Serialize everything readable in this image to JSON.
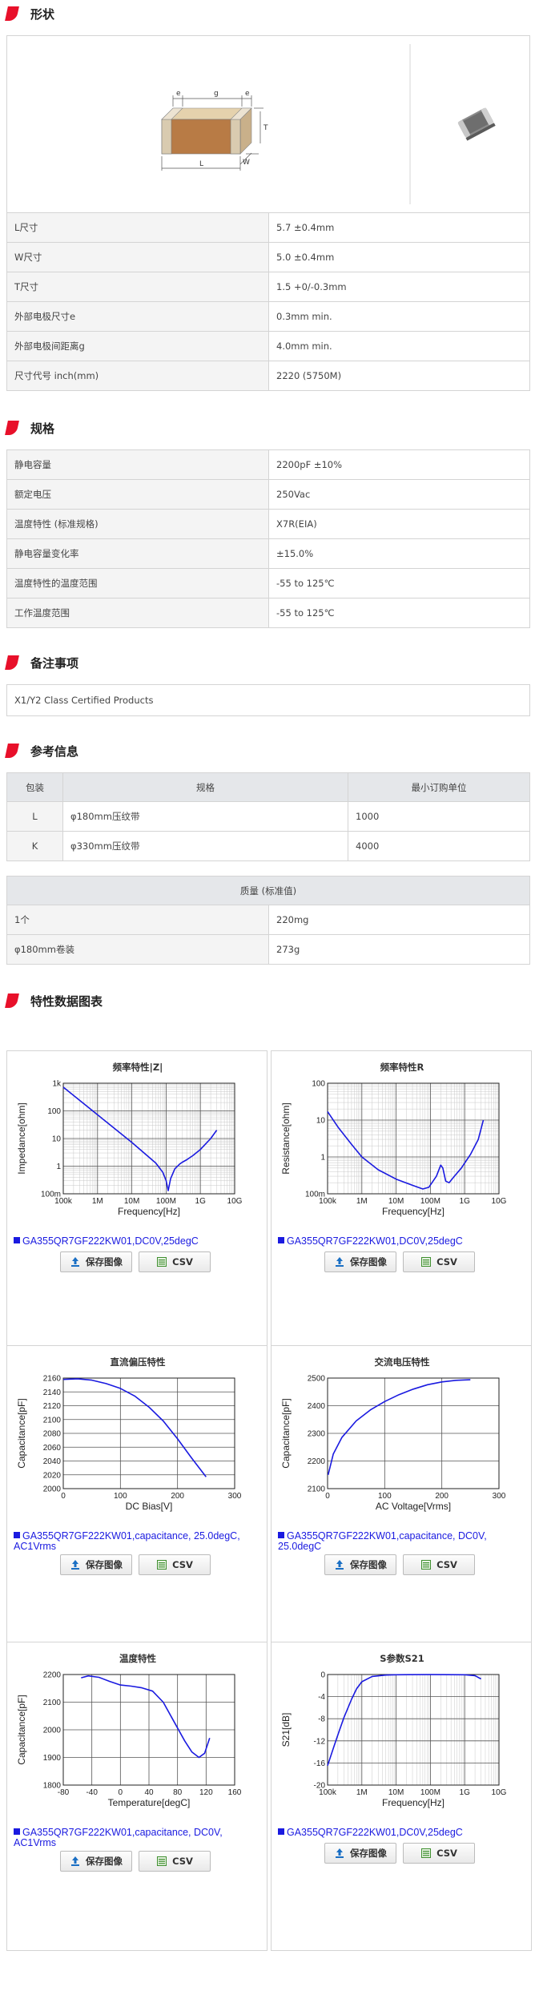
{
  "sections": {
    "shape": "形状",
    "spec": "规格",
    "remarks": "备注事项",
    "reference": "参考信息",
    "charts": "特性数据图表"
  },
  "dimension_labels": {
    "e": "e",
    "g": "g",
    "T": "T",
    "L": "L",
    "W": "W"
  },
  "shape_rows": [
    {
      "label": "L尺寸",
      "value": "5.7 ±0.4mm"
    },
    {
      "label": "W尺寸",
      "value": "5.0 ±0.4mm"
    },
    {
      "label": "T尺寸",
      "value": "1.5 +0/-0.3mm"
    },
    {
      "label": "外部电极尺寸e",
      "value": "0.3mm min."
    },
    {
      "label": "外部电极间距离g",
      "value": "4.0mm min."
    },
    {
      "label": "尺寸代号 inch(mm)",
      "value": "2220 (5750M)"
    }
  ],
  "spec_rows": [
    {
      "label": "静电容量",
      "value": "2200pF ±10%"
    },
    {
      "label": "额定电压",
      "value": "250Vac"
    },
    {
      "label": "温度特性 (标准规格)",
      "value": "X7R(EIA)"
    },
    {
      "label": "静电容量变化率",
      "value": "±15.0%"
    },
    {
      "label": "温度特性的温度范围",
      "value": "-55 to 125℃"
    },
    {
      "label": "工作温度范围",
      "value": "-55 to 125℃"
    }
  ],
  "remarks": "X1/Y2 Class Certified Products",
  "packaging": {
    "headers": [
      "包装",
      "规格",
      "最小订购单位"
    ],
    "rows": [
      [
        "L",
        "φ180mm压纹带",
        "1000"
      ],
      [
        "K",
        "φ330mm压纹带",
        "4000"
      ]
    ]
  },
  "mass": {
    "header": "质量 (标准值)",
    "rows": [
      {
        "label": "1个",
        "value": "220mg"
      },
      {
        "label": "φ180mm卷装",
        "value": "273g"
      }
    ]
  },
  "buttons": {
    "save": "保存图像",
    "csv": "CSV"
  },
  "colors": {
    "accent": "#e8102a",
    "series": "#1a1ae0"
  },
  "chart_data": [
    {
      "id": "z",
      "type": "line",
      "title": "频率特性|Z|",
      "xlabel": "Frequency[Hz]",
      "ylabel": "Impedance[ohm]",
      "xscale": "log",
      "yscale": "log",
      "xlim": [
        100000,
        10000000000
      ],
      "ylim": [
        0.1,
        1000
      ],
      "xticks": [
        {
          "v": 100000,
          "t": "100k"
        },
        {
          "v": 1000000,
          "t": "1M"
        },
        {
          "v": 10000000,
          "t": "10M"
        },
        {
          "v": 100000000,
          "t": "100M"
        },
        {
          "v": 1000000000,
          "t": "1G"
        },
        {
          "v": 10000000000,
          "t": "10G"
        }
      ],
      "yticks": [
        {
          "v": 0.1,
          "t": "100m"
        },
        {
          "v": 1,
          "t": "1"
        },
        {
          "v": 10,
          "t": "10"
        },
        {
          "v": 100,
          "t": "100"
        },
        {
          "v": 1000,
          "t": "1k"
        }
      ],
      "legend": "GA355QR7GF222KW01,DC0V,25degC",
      "points": [
        [
          100000,
          720
        ],
        [
          1000000,
          72
        ],
        [
          10000000,
          7.2
        ],
        [
          50000000,
          1.3
        ],
        [
          80000000,
          0.6
        ],
        [
          100000000,
          0.3
        ],
        [
          115000000,
          0.13
        ],
        [
          135000000,
          0.35
        ],
        [
          180000000,
          0.8
        ],
        [
          250000000,
          1.2
        ],
        [
          300000000,
          1.4
        ],
        [
          400000000,
          1.7
        ],
        [
          600000000,
          2.4
        ],
        [
          1000000000,
          4.0
        ],
        [
          2000000000,
          10
        ],
        [
          3000000000,
          20
        ]
      ]
    },
    {
      "id": "r",
      "type": "line",
      "title": "频率特性R",
      "xlabel": "Frequency[Hz]",
      "ylabel": "Resistance[ohm]",
      "xscale": "log",
      "yscale": "log",
      "xlim": [
        100000,
        10000000000
      ],
      "ylim": [
        0.1,
        100
      ],
      "xticks": [
        {
          "v": 100000,
          "t": "100k"
        },
        {
          "v": 1000000,
          "t": "1M"
        },
        {
          "v": 10000000,
          "t": "10M"
        },
        {
          "v": 100000000,
          "t": "100M"
        },
        {
          "v": 1000000000,
          "t": "1G"
        },
        {
          "v": 10000000000,
          "t": "10G"
        }
      ],
      "yticks": [
        {
          "v": 0.1,
          "t": "100m"
        },
        {
          "v": 1,
          "t": "1"
        },
        {
          "v": 10,
          "t": "10"
        },
        {
          "v": 100,
          "t": "100"
        }
      ],
      "legend": "GA355QR7GF222KW01,DC0V,25degC",
      "points": [
        [
          100000,
          17
        ],
        [
          200000,
          6.5
        ],
        [
          500000,
          2.2
        ],
        [
          1000000,
          1.0
        ],
        [
          3000000,
          0.45
        ],
        [
          10000000,
          0.25
        ],
        [
          30000000,
          0.17
        ],
        [
          60000000,
          0.135
        ],
        [
          90000000,
          0.15
        ],
        [
          150000000,
          0.3
        ],
        [
          200000000,
          0.6
        ],
        [
          230000000,
          0.5
        ],
        [
          280000000,
          0.22
        ],
        [
          350000000,
          0.2
        ],
        [
          500000000,
          0.3
        ],
        [
          800000000,
          0.5
        ],
        [
          1500000000,
          1.2
        ],
        [
          2500000000,
          3
        ],
        [
          3500000000,
          10
        ]
      ]
    },
    {
      "id": "dcbias",
      "type": "line",
      "title": "直流偏压特性",
      "xlabel": "DC Bias[V]",
      "ylabel": "Capacitance[pF]",
      "xscale": "linear",
      "yscale": "linear",
      "xlim": [
        0,
        300
      ],
      "ylim": [
        2000,
        2160
      ],
      "xticks": [
        {
          "v": 0,
          "t": "0"
        },
        {
          "v": 100,
          "t": "100"
        },
        {
          "v": 200,
          "t": "200"
        },
        {
          "v": 300,
          "t": "300"
        }
      ],
      "yticks": [
        {
          "v": 2000,
          "t": "2000"
        },
        {
          "v": 2020,
          "t": "2020"
        },
        {
          "v": 2040,
          "t": "2040"
        },
        {
          "v": 2060,
          "t": "2060"
        },
        {
          "v": 2080,
          "t": "2080"
        },
        {
          "v": 2100,
          "t": "2100"
        },
        {
          "v": 2120,
          "t": "2120"
        },
        {
          "v": 2140,
          "t": "2140"
        },
        {
          "v": 2160,
          "t": "2160"
        }
      ],
      "legend": "GA355QR7GF222KW01,capacitance, 25.0degC, AC1Vrms",
      "points": [
        [
          0,
          2158
        ],
        [
          25,
          2159
        ],
        [
          50,
          2157
        ],
        [
          75,
          2152
        ],
        [
          100,
          2145
        ],
        [
          125,
          2134
        ],
        [
          150,
          2118
        ],
        [
          175,
          2098
        ],
        [
          200,
          2072
        ],
        [
          225,
          2044
        ],
        [
          250,
          2017
        ]
      ]
    },
    {
      "id": "acv",
      "type": "line",
      "title": "交流电压特性",
      "xlabel": "AC Voltage[Vrms]",
      "ylabel": "Capacitance[pF]",
      "xscale": "linear",
      "yscale": "linear",
      "xlim": [
        0,
        300
      ],
      "ylim": [
        2100,
        2500
      ],
      "xticks": [
        {
          "v": 0,
          "t": "0"
        },
        {
          "v": 100,
          "t": "100"
        },
        {
          "v": 200,
          "t": "200"
        },
        {
          "v": 300,
          "t": "300"
        }
      ],
      "yticks": [
        {
          "v": 2100,
          "t": "2100"
        },
        {
          "v": 2200,
          "t": "2200"
        },
        {
          "v": 2300,
          "t": "2300"
        },
        {
          "v": 2400,
          "t": "2400"
        },
        {
          "v": 2500,
          "t": "2500"
        }
      ],
      "legend": "GA355QR7GF222KW01,capacitance, DC0V, 25.0degC",
      "points": [
        [
          1,
          2150
        ],
        [
          10,
          2225
        ],
        [
          25,
          2285
        ],
        [
          50,
          2345
        ],
        [
          75,
          2385
        ],
        [
          100,
          2415
        ],
        [
          125,
          2440
        ],
        [
          150,
          2460
        ],
        [
          175,
          2476
        ],
        [
          200,
          2486
        ],
        [
          225,
          2492
        ],
        [
          250,
          2494
        ]
      ]
    },
    {
      "id": "temp",
      "type": "line",
      "title": "温度特性",
      "xlabel": "Temperature[degC]",
      "ylabel": "Capacitance[pF]",
      "xscale": "linear",
      "yscale": "linear",
      "xlim": [
        -80,
        160
      ],
      "ylim": [
        1800,
        2200
      ],
      "xticks": [
        {
          "v": -80,
          "t": "-80"
        },
        {
          "v": -40,
          "t": "-40"
        },
        {
          "v": 0,
          "t": "0"
        },
        {
          "v": 40,
          "t": "40"
        },
        {
          "v": 80,
          "t": "80"
        },
        {
          "v": 120,
          "t": "120"
        },
        {
          "v": 160,
          "t": "160"
        }
      ],
      "yticks": [
        {
          "v": 1800,
          "t": "1800"
        },
        {
          "v": 1900,
          "t": "1900"
        },
        {
          "v": 2000,
          "t": "2000"
        },
        {
          "v": 2100,
          "t": "2100"
        },
        {
          "v": 2200,
          "t": "2200"
        }
      ],
      "legend": "GA355QR7GF222KW01,capacitance, DC0V, AC1Vrms",
      "points": [
        [
          -55,
          2188
        ],
        [
          -45,
          2195
        ],
        [
          -30,
          2190
        ],
        [
          -15,
          2175
        ],
        [
          0,
          2162
        ],
        [
          15,
          2158
        ],
        [
          30,
          2152
        ],
        [
          45,
          2140
        ],
        [
          60,
          2100
        ],
        [
          75,
          2030
        ],
        [
          90,
          1960
        ],
        [
          100,
          1920
        ],
        [
          110,
          1900
        ],
        [
          118,
          1915
        ],
        [
          125,
          1970
        ]
      ]
    },
    {
      "id": "s21",
      "type": "line",
      "title": "S参数S21",
      "xlabel": "Frequency[Hz]",
      "ylabel": "S21[dB]",
      "xscale": "log",
      "yscale": "linear",
      "xlim": [
        100000,
        10000000000
      ],
      "ylim": [
        -20,
        0
      ],
      "xticks": [
        {
          "v": 100000,
          "t": "100k"
        },
        {
          "v": 1000000,
          "t": "1M"
        },
        {
          "v": 10000000,
          "t": "10M"
        },
        {
          "v": 100000000,
          "t": "100M"
        },
        {
          "v": 1000000000,
          "t": "1G"
        },
        {
          "v": 10000000000,
          "t": "10G"
        }
      ],
      "yticks": [
        {
          "v": -20,
          "t": "-20"
        },
        {
          "v": -16,
          "t": "-16"
        },
        {
          "v": -12,
          "t": "-12"
        },
        {
          "v": -8,
          "t": "-8"
        },
        {
          "v": -4,
          "t": "-4"
        },
        {
          "v": 0,
          "t": "0"
        }
      ],
      "legend": "GA355QR7GF222KW01,DC0V,25degC",
      "points": [
        [
          100000,
          -16.5
        ],
        [
          150000,
          -13.2
        ],
        [
          200000,
          -10.9
        ],
        [
          300000,
          -7.8
        ],
        [
          500000,
          -4.5
        ],
        [
          700000,
          -2.6
        ],
        [
          1000000,
          -1.3
        ],
        [
          2000000,
          -0.35
        ],
        [
          5000000,
          -0.1
        ],
        [
          10000000,
          -0.05
        ],
        [
          100000000,
          -0.02
        ],
        [
          1000000000,
          -0.05
        ],
        [
          2000000000,
          -0.2
        ],
        [
          3000000000,
          -0.8
        ]
      ]
    }
  ]
}
